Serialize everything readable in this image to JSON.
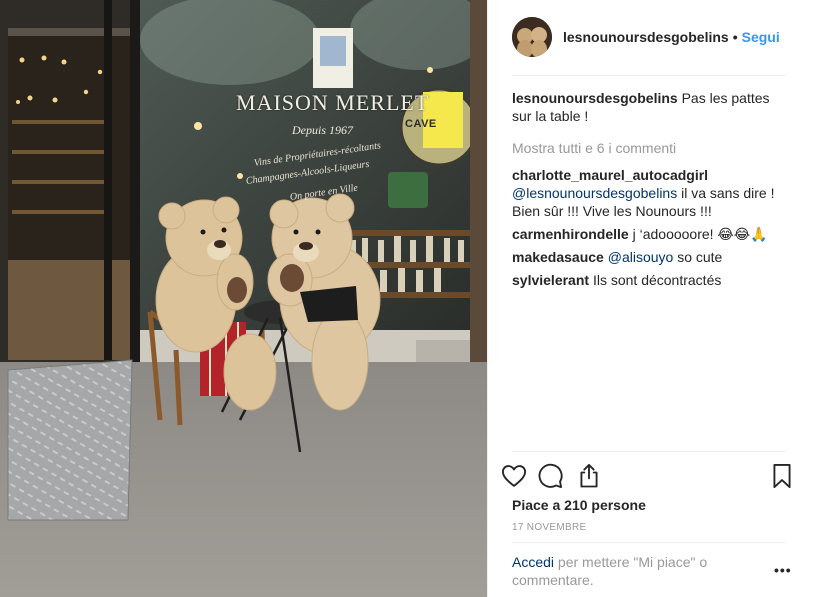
{
  "post": {
    "photo": {
      "sign_title": "MAISON MERLET",
      "sign_since": "Depuis 1967",
      "sign_line_1": "Vins de Propriétaires-récoltants",
      "sign_line_2": "Champagnes-Alcools-Liqueurs",
      "sign_line_3": "On porte en Ville",
      "badge_text": "CAVE"
    },
    "header": {
      "username": "lesnounoursdesgobelins",
      "separator": "•",
      "follow_label": "Segui",
      "avatar_icon": "profile-picture"
    },
    "caption": {
      "username": "lesnounoursdesgobelins",
      "text": "Pas les pattes sur la table !"
    },
    "view_all_comments": "Mostra tutti e 6 i commenti",
    "comments": [
      {
        "username": "charlotte_maurel_autocadgirl",
        "mention": "@lesnounoursdesgobelins",
        "text": " il va sans dire ! Bien sûr !!! Vive les Nounours !!!"
      },
      {
        "username": "carmenhirondelle",
        "mention": "",
        "text": "j ‘adooooore! 😂😂🙏"
      },
      {
        "username": "makedasauce",
        "mention": "@alisouyo",
        "text": " so cute"
      },
      {
        "username": "sylvielerant",
        "mention": "",
        "text": "Ils sont décontractés"
      }
    ],
    "actions": {
      "like_icon": "heart-icon",
      "comment_icon": "comment-icon",
      "share_icon": "share-icon",
      "save_icon": "bookmark-icon"
    },
    "likes_text": "Piace a 210 persone",
    "date": "17 NOVEMBRE",
    "login_prompt": {
      "link": "Accedi",
      "text": " per mettere \"Mi piace\" o commentare."
    },
    "more_label": "•••"
  },
  "colors": {
    "link_blue": "#3897f0",
    "mention_blue": "#003569",
    "muted_gray": "#999999",
    "text_dark": "#262626",
    "divider": "#efefef"
  }
}
